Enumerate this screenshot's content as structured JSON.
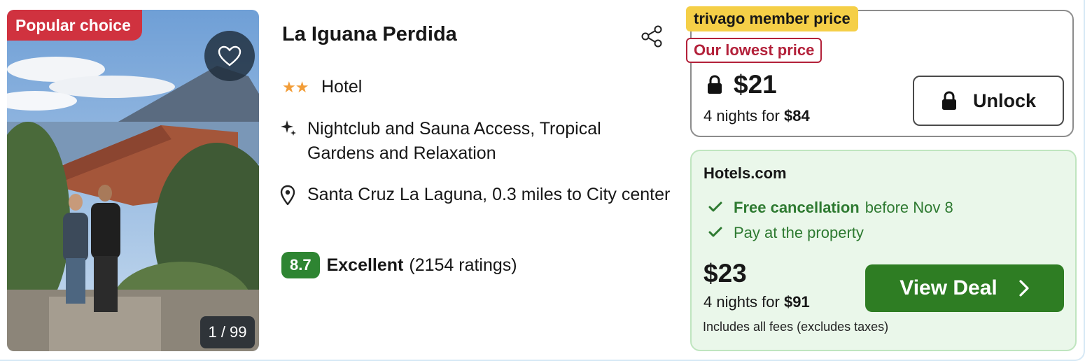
{
  "image": {
    "badge": "Popular choice",
    "counter": "1 / 99"
  },
  "hotel": {
    "name": "La Iguana Perdida",
    "stars": 2,
    "stars_text": "★★",
    "type": "Hotel",
    "highlight": "Nightclub and Sauna Access, Tropical Gardens and Relaxation",
    "location": "Santa Cruz La Laguna, 0.3 miles to City center",
    "rating": {
      "score": "8.7",
      "label": "Excellent",
      "count": "(2154 ratings)"
    }
  },
  "member_offer": {
    "tag": "trivago member price",
    "lowest_tag": "Our lowest price",
    "price": "$21",
    "nights_text": "4 nights for",
    "total": "$84",
    "unlock_label": "Unlock"
  },
  "deal": {
    "provider": "Hotels.com",
    "perk1_bold": "Free cancellation",
    "perk1_rest": "before Nov 8",
    "perk2": "Pay at the property",
    "price": "$23",
    "nights_text": "4 nights for",
    "total": "$91",
    "fees": "Includes all fees (excludes taxes)",
    "cta_label": "View Deal"
  },
  "colors": {
    "popular_badge": "#d0323f",
    "score_badge": "#2e8532",
    "member_tag": "#f5cf47",
    "lowest_tag": "#b3213a",
    "deal_bg": "#eaf7ea",
    "cta": "#2e7d23",
    "stars": "#f29d38"
  },
  "icons": {
    "favorite": "heart-icon",
    "share": "share-icon",
    "highlight": "sparkle-icon",
    "location": "map-pin-icon",
    "lock": "lock-icon",
    "check": "check-icon",
    "chevron": "chevron-right-icon"
  }
}
